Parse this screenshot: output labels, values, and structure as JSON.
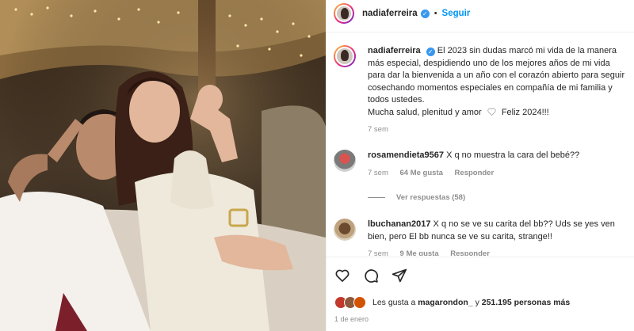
{
  "post": {
    "author": "nadiaferreira",
    "follow_label": "Seguir",
    "dot": "•"
  },
  "caption": {
    "username": "nadiaferreira",
    "text": "El 2023 sin dudas marcó mi vida de la manera más especial, despidiendo uno de los mejores años de mi vida para dar la bienvenida a un año con el corazón abierto para seguir cosechando momentos especiales en compañía de mi familia y todos ustedes.",
    "text2a": "Mucha salud, plenitud y amor",
    "text2b": "Feliz 2024!!!",
    "time": "7 sem"
  },
  "comments": [
    {
      "username": "rosamendieta9567",
      "text": "X q no muestra la cara del bebé??",
      "time": "7 sem",
      "likes": "64 Me gusta",
      "reply": "Responder"
    },
    {
      "username": "lbuchanan2017",
      "text": "X q no se ve su carita del bb?? Uds se yes ven bien, pero El bb nunca se ve su carita, strange!!",
      "time": "7 sem",
      "likes": "9 Me gusta",
      "reply": "Responder"
    }
  ],
  "view_replies": "Ver respuestas (58)",
  "likes_line": {
    "prefix": "Les gusta a",
    "user": "magarondon_",
    "mid": "y",
    "count": "251.195 personas más"
  },
  "date": "1 de enero",
  "colors": {
    "accent": "#0095f6",
    "verified": "#3897f0",
    "muted": "#8e8e8e"
  }
}
